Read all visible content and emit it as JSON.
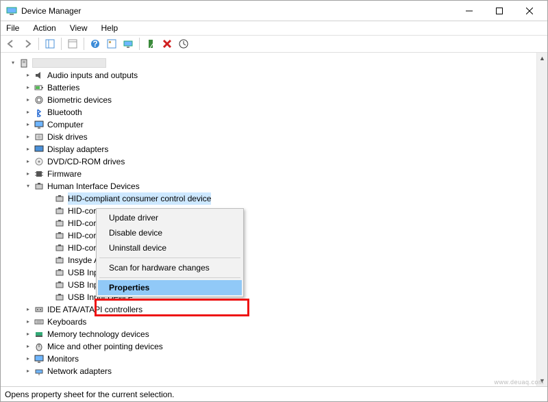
{
  "window": {
    "title": "Device Manager"
  },
  "menu": {
    "file": "File",
    "action": "Action",
    "view": "View",
    "help": "Help"
  },
  "tree": {
    "root_label": "",
    "items": [
      {
        "label": "Audio inputs and outputs",
        "icon": "speaker"
      },
      {
        "label": "Batteries",
        "icon": "battery"
      },
      {
        "label": "Biometric devices",
        "icon": "fingerprint"
      },
      {
        "label": "Bluetooth",
        "icon": "bluetooth"
      },
      {
        "label": "Computer",
        "icon": "monitor"
      },
      {
        "label": "Disk drives",
        "icon": "disk"
      },
      {
        "label": "Display adapters",
        "icon": "display"
      },
      {
        "label": "DVD/CD-ROM drives",
        "icon": "cd"
      },
      {
        "label": "Firmware",
        "icon": "chip"
      },
      {
        "label": "Human Interface Devices",
        "icon": "hid",
        "expanded": true,
        "children": [
          {
            "label": "HID-compliant consumer control device",
            "selected": true
          },
          {
            "label": "HID-cor"
          },
          {
            "label": "HID-cor"
          },
          {
            "label": "HID-cor"
          },
          {
            "label": "HID-cor"
          },
          {
            "label": "Insyde A"
          },
          {
            "label": "USB Inp"
          },
          {
            "label": "USB Inp"
          },
          {
            "label": "USB Input Device"
          }
        ]
      },
      {
        "label": "IDE ATA/ATAPI controllers",
        "icon": "ide"
      },
      {
        "label": "Keyboards",
        "icon": "keyboard"
      },
      {
        "label": "Memory technology devices",
        "icon": "memory"
      },
      {
        "label": "Mice and other pointing devices",
        "icon": "mouse"
      },
      {
        "label": "Monitors",
        "icon": "monitor"
      },
      {
        "label": "Network adapters",
        "icon": "network"
      }
    ]
  },
  "context_menu": {
    "update": "Update driver",
    "disable": "Disable device",
    "uninstall": "Uninstall device",
    "scan": "Scan for hardware changes",
    "properties": "Properties"
  },
  "status": "Opens property sheet for the current selection.",
  "watermark": "www.deuaq.com"
}
